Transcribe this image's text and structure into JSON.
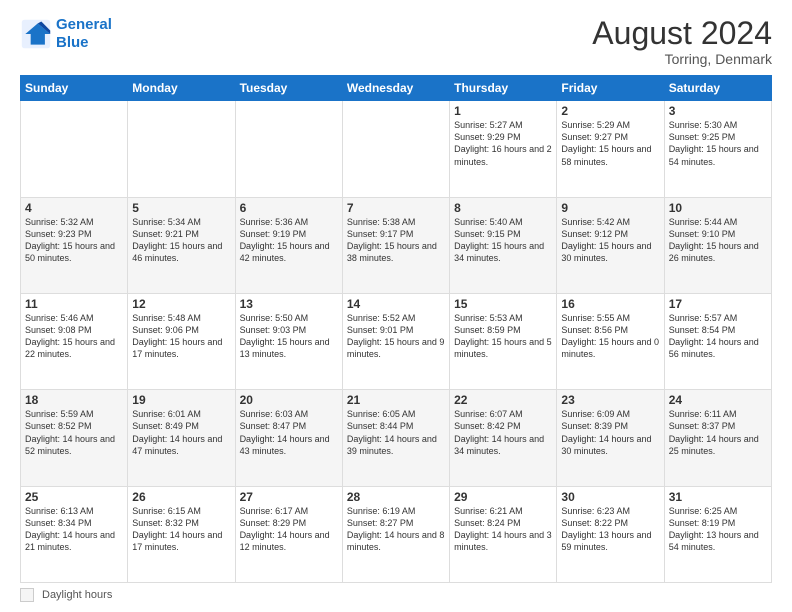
{
  "header": {
    "logo_line1": "General",
    "logo_line2": "Blue",
    "month_year": "August 2024",
    "location": "Torring, Denmark"
  },
  "days_of_week": [
    "Sunday",
    "Monday",
    "Tuesday",
    "Wednesday",
    "Thursday",
    "Friday",
    "Saturday"
  ],
  "footer": {
    "daylight_label": "Daylight hours"
  },
  "weeks": [
    [
      {
        "day": "",
        "info": ""
      },
      {
        "day": "",
        "info": ""
      },
      {
        "day": "",
        "info": ""
      },
      {
        "day": "",
        "info": ""
      },
      {
        "day": "1",
        "info": "Sunrise: 5:27 AM\nSunset: 9:29 PM\nDaylight: 16 hours\nand 2 minutes."
      },
      {
        "day": "2",
        "info": "Sunrise: 5:29 AM\nSunset: 9:27 PM\nDaylight: 15 hours\nand 58 minutes."
      },
      {
        "day": "3",
        "info": "Sunrise: 5:30 AM\nSunset: 9:25 PM\nDaylight: 15 hours\nand 54 minutes."
      }
    ],
    [
      {
        "day": "4",
        "info": "Sunrise: 5:32 AM\nSunset: 9:23 PM\nDaylight: 15 hours\nand 50 minutes."
      },
      {
        "day": "5",
        "info": "Sunrise: 5:34 AM\nSunset: 9:21 PM\nDaylight: 15 hours\nand 46 minutes."
      },
      {
        "day": "6",
        "info": "Sunrise: 5:36 AM\nSunset: 9:19 PM\nDaylight: 15 hours\nand 42 minutes."
      },
      {
        "day": "7",
        "info": "Sunrise: 5:38 AM\nSunset: 9:17 PM\nDaylight: 15 hours\nand 38 minutes."
      },
      {
        "day": "8",
        "info": "Sunrise: 5:40 AM\nSunset: 9:15 PM\nDaylight: 15 hours\nand 34 minutes."
      },
      {
        "day": "9",
        "info": "Sunrise: 5:42 AM\nSunset: 9:12 PM\nDaylight: 15 hours\nand 30 minutes."
      },
      {
        "day": "10",
        "info": "Sunrise: 5:44 AM\nSunset: 9:10 PM\nDaylight: 15 hours\nand 26 minutes."
      }
    ],
    [
      {
        "day": "11",
        "info": "Sunrise: 5:46 AM\nSunset: 9:08 PM\nDaylight: 15 hours\nand 22 minutes."
      },
      {
        "day": "12",
        "info": "Sunrise: 5:48 AM\nSunset: 9:06 PM\nDaylight: 15 hours\nand 17 minutes."
      },
      {
        "day": "13",
        "info": "Sunrise: 5:50 AM\nSunset: 9:03 PM\nDaylight: 15 hours\nand 13 minutes."
      },
      {
        "day": "14",
        "info": "Sunrise: 5:52 AM\nSunset: 9:01 PM\nDaylight: 15 hours\nand 9 minutes."
      },
      {
        "day": "15",
        "info": "Sunrise: 5:53 AM\nSunset: 8:59 PM\nDaylight: 15 hours\nand 5 minutes."
      },
      {
        "day": "16",
        "info": "Sunrise: 5:55 AM\nSunset: 8:56 PM\nDaylight: 15 hours\nand 0 minutes."
      },
      {
        "day": "17",
        "info": "Sunrise: 5:57 AM\nSunset: 8:54 PM\nDaylight: 14 hours\nand 56 minutes."
      }
    ],
    [
      {
        "day": "18",
        "info": "Sunrise: 5:59 AM\nSunset: 8:52 PM\nDaylight: 14 hours\nand 52 minutes."
      },
      {
        "day": "19",
        "info": "Sunrise: 6:01 AM\nSunset: 8:49 PM\nDaylight: 14 hours\nand 47 minutes."
      },
      {
        "day": "20",
        "info": "Sunrise: 6:03 AM\nSunset: 8:47 PM\nDaylight: 14 hours\nand 43 minutes."
      },
      {
        "day": "21",
        "info": "Sunrise: 6:05 AM\nSunset: 8:44 PM\nDaylight: 14 hours\nand 39 minutes."
      },
      {
        "day": "22",
        "info": "Sunrise: 6:07 AM\nSunset: 8:42 PM\nDaylight: 14 hours\nand 34 minutes."
      },
      {
        "day": "23",
        "info": "Sunrise: 6:09 AM\nSunset: 8:39 PM\nDaylight: 14 hours\nand 30 minutes."
      },
      {
        "day": "24",
        "info": "Sunrise: 6:11 AM\nSunset: 8:37 PM\nDaylight: 14 hours\nand 25 minutes."
      }
    ],
    [
      {
        "day": "25",
        "info": "Sunrise: 6:13 AM\nSunset: 8:34 PM\nDaylight: 14 hours\nand 21 minutes."
      },
      {
        "day": "26",
        "info": "Sunrise: 6:15 AM\nSunset: 8:32 PM\nDaylight: 14 hours\nand 17 minutes."
      },
      {
        "day": "27",
        "info": "Sunrise: 6:17 AM\nSunset: 8:29 PM\nDaylight: 14 hours\nand 12 minutes."
      },
      {
        "day": "28",
        "info": "Sunrise: 6:19 AM\nSunset: 8:27 PM\nDaylight: 14 hours\nand 8 minutes."
      },
      {
        "day": "29",
        "info": "Sunrise: 6:21 AM\nSunset: 8:24 PM\nDaylight: 14 hours\nand 3 minutes."
      },
      {
        "day": "30",
        "info": "Sunrise: 6:23 AM\nSunset: 8:22 PM\nDaylight: 13 hours\nand 59 minutes."
      },
      {
        "day": "31",
        "info": "Sunrise: 6:25 AM\nSunset: 8:19 PM\nDaylight: 13 hours\nand 54 minutes."
      }
    ]
  ]
}
